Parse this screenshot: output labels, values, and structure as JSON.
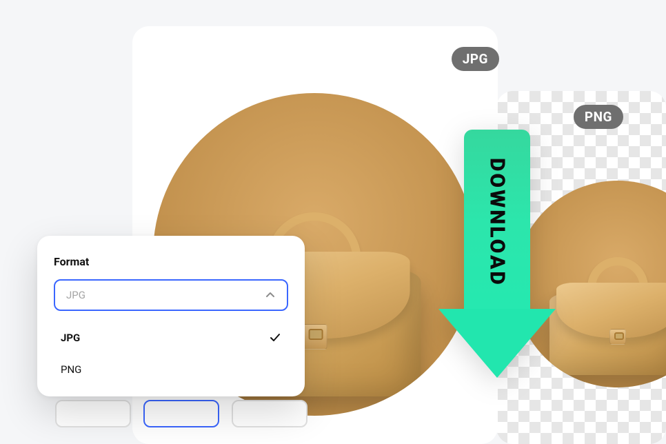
{
  "badges": {
    "jpg": "JPG",
    "png": "PNG"
  },
  "download_arrow": {
    "label": "DOWNLOAD"
  },
  "format_panel": {
    "title": "Format",
    "selected_value": "JPG",
    "options": [
      {
        "label": "JPG",
        "selected": true
      },
      {
        "label": "PNG",
        "selected": false
      }
    ]
  }
}
